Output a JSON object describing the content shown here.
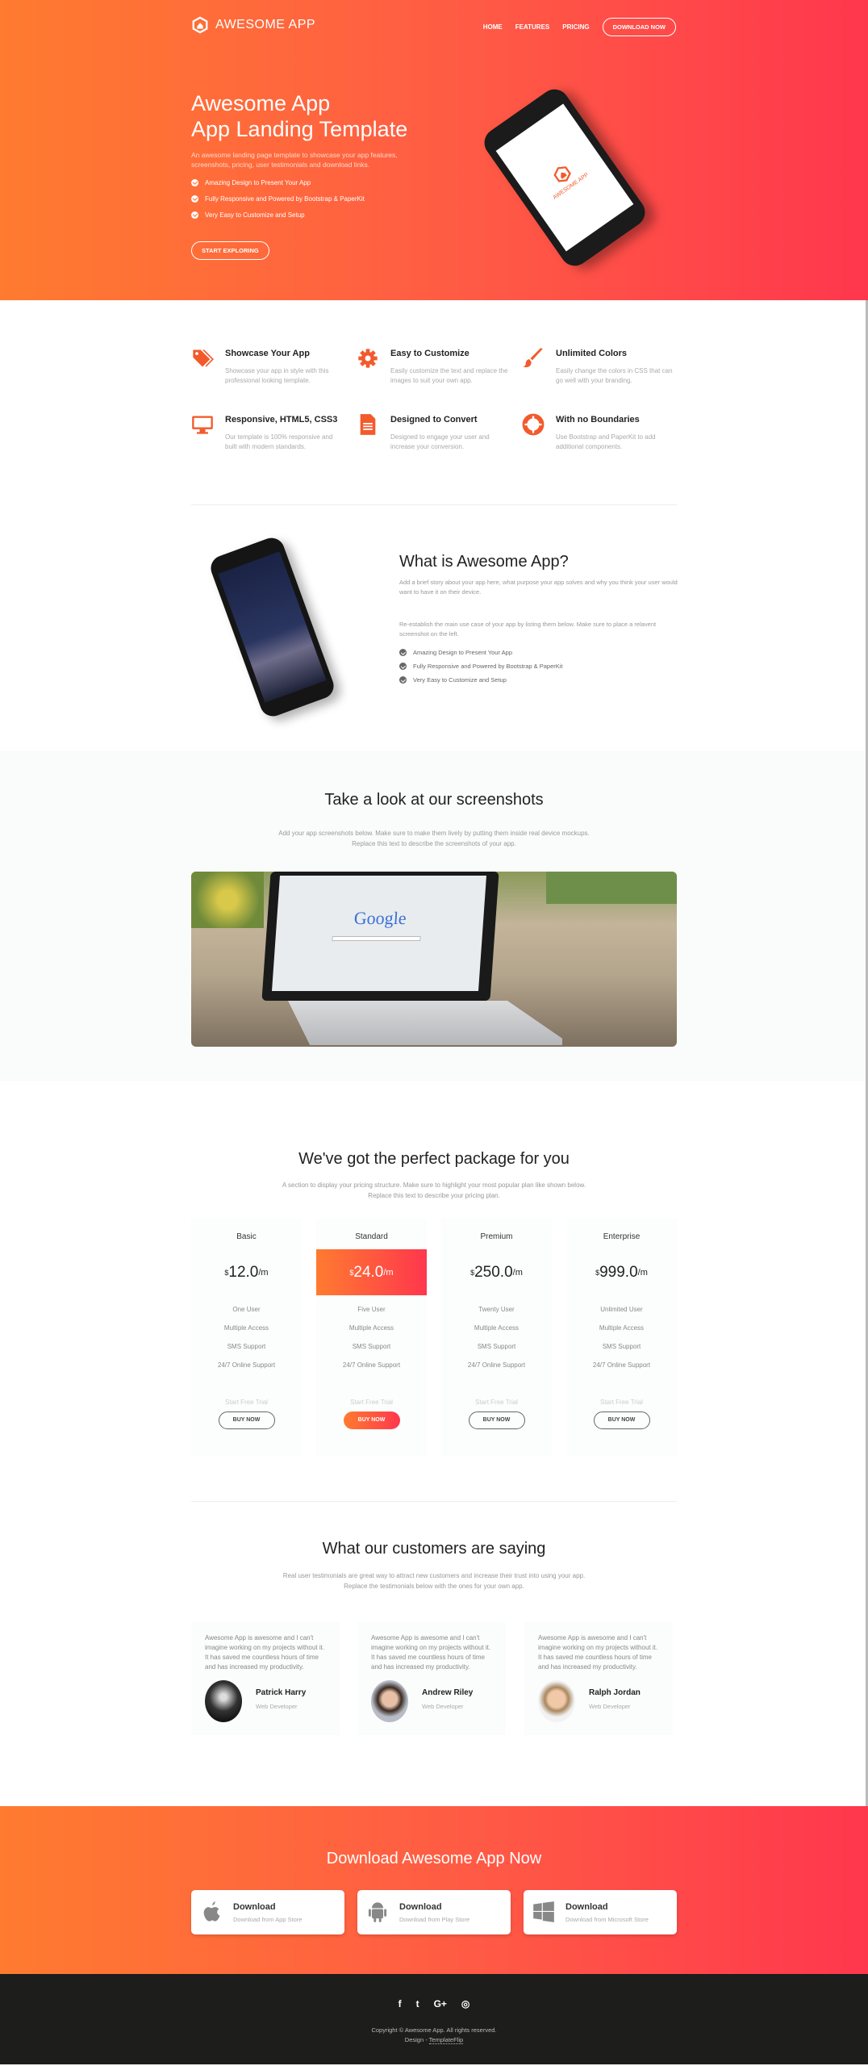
{
  "colors": {
    "accent_start": "#ff7b30",
    "accent_end": "#ff374d",
    "icon": "#f25a2c",
    "footer_bg": "#1d1d1b"
  },
  "nav": {
    "logo_text": "AWESOME APP",
    "links": [
      "HOME",
      "FEATURES",
      "PRICING"
    ],
    "cta": "DOWNLOAD NOW"
  },
  "hero": {
    "title_line1": "Awesome App",
    "title_line2": "App Landing Template",
    "description": "An awesome landing page template to showcase your app features, screenshots, pricing, user testimonials and download links.",
    "bullets": [
      "Amazing Design to Present Your App",
      "Fully Responsive and Powered by Bootstrap & PaperKit",
      "Very Easy to Customize and Setup"
    ],
    "button": "START EXPLORING",
    "phone_screen_text": "AWESOME APP"
  },
  "features": [
    {
      "icon": "tags-icon",
      "title": "Showcase Your App",
      "text": "Showcase your app in style with this professional looking template."
    },
    {
      "icon": "gear-icon",
      "title": "Easy to Customize",
      "text": "Easily customize the text and replace the images to suit your own app."
    },
    {
      "icon": "paintbrush-icon",
      "title": "Unlimited Colors",
      "text": "Easily change the colors in CSS that can go well with your branding."
    },
    {
      "icon": "monitor-icon",
      "title": "Responsive, HTML5, CSS3",
      "text": "Our template is 100% responsive and built with modern standards."
    },
    {
      "icon": "document-icon",
      "title": "Designed to Convert",
      "text": "Designed to engage your user and increase your conversion."
    },
    {
      "icon": "lifebuoy-icon",
      "title": "With no Boundaries",
      "text": "Use Bootstrap and PaperKit to add additional components."
    }
  ],
  "about": {
    "title": "What is Awesome App?",
    "p1": "Add a brief story about your app here, what purpose your app solves and why you think your user would want to have it on their device.",
    "p2": "Re-establish the main use case of your app by listing them below. Make sure to place a relavent screenshot on the left.",
    "bullets": [
      "Amazing Design to Present Your App",
      "Fully Responsive and Powered by Bootstrap & PaperKit",
      "Very Easy to Customize and Setup"
    ]
  },
  "screenshots": {
    "title": "Take a look at our screenshots",
    "sub1": "Add your app screenshots below. Make sure to make them lively by putting them inside real device mockups.",
    "sub2": "Replace this text to describe the screenshots of your app.",
    "image_text": "Google"
  },
  "pricing": {
    "title": "We've got the perfect package for you",
    "sub1": "A section to display your pricing structure. Make sure to highlight your most popular plan like shown below.",
    "sub2": "Replace this text to describe your pricing plan.",
    "plans": [
      {
        "name": "Basic",
        "currency": "$",
        "price": "12.0",
        "per": "/m",
        "features": [
          "One User",
          "Multiple Access",
          "SMS Support",
          "24/7 Online Support"
        ],
        "trial": "Start Free Trial",
        "button": "BUY NOW"
      },
      {
        "name": "Standard",
        "currency": "$",
        "price": "24.0",
        "per": "/m",
        "features": [
          "Five User",
          "Multiple Access",
          "SMS Support",
          "24/7 Online Support"
        ],
        "trial": "Start Free Trial",
        "button": "BUY NOW",
        "highlighted": true
      },
      {
        "name": "Premium",
        "currency": "$",
        "price": "250.0",
        "per": "/m",
        "features": [
          "Twenty User",
          "Multiple Access",
          "SMS Support",
          "24/7 Online Support"
        ],
        "trial": "Start Free Trial",
        "button": "BUY NOW"
      },
      {
        "name": "Enterprise",
        "currency": "$",
        "price": "999.0",
        "per": "/m",
        "features": [
          "Unlimited User",
          "Multiple Access",
          "SMS Support",
          "24/7 Online Support"
        ],
        "trial": "Start Free Trial",
        "button": "BUY NOW"
      }
    ]
  },
  "testimonials": {
    "title": "What our customers are saying",
    "sub1": "Real user testimonials are great way to attract new customers and increase their trust into using your app.",
    "sub2": "Replace the testimonials below with the ones for your own app.",
    "items": [
      {
        "quote": "Awesome App is awesome and I can't imagine working on my projects without it. It has saved me countless hours of time and has increased my productivity.",
        "name": "Patrick Harry",
        "role": "Web Developer"
      },
      {
        "quote": "Awesome App is awesome and I can't imagine working on my projects without it. It has saved me countless hours of time and has increased my productivity.",
        "name": "Andrew Riley",
        "role": "Web Developer"
      },
      {
        "quote": "Awesome App is awesome and I can't imagine working on my projects without it. It has saved me countless hours of time and has increased my productivity.",
        "name": "Ralph Jordan",
        "role": "Web Developer"
      }
    ]
  },
  "download": {
    "title": "Download Awesome App Now",
    "stores": [
      {
        "icon": "apple-icon",
        "title": "Download",
        "sub": "Download from App Store"
      },
      {
        "icon": "android-icon",
        "title": "Download",
        "sub": "Download from Play Store"
      },
      {
        "icon": "windows-icon",
        "title": "Download",
        "sub": "Download from Microsoft Store"
      }
    ]
  },
  "footer": {
    "social": [
      "facebook-icon",
      "twitter-icon",
      "google-plus-icon",
      "instagram-icon"
    ],
    "social_glyphs": [
      "f",
      "t",
      "G+",
      "◎"
    ],
    "copyright": "Copyright © Awesome App. All rights reserved.",
    "design_prefix": "Design - ",
    "design_link": "TemplateFlip"
  }
}
